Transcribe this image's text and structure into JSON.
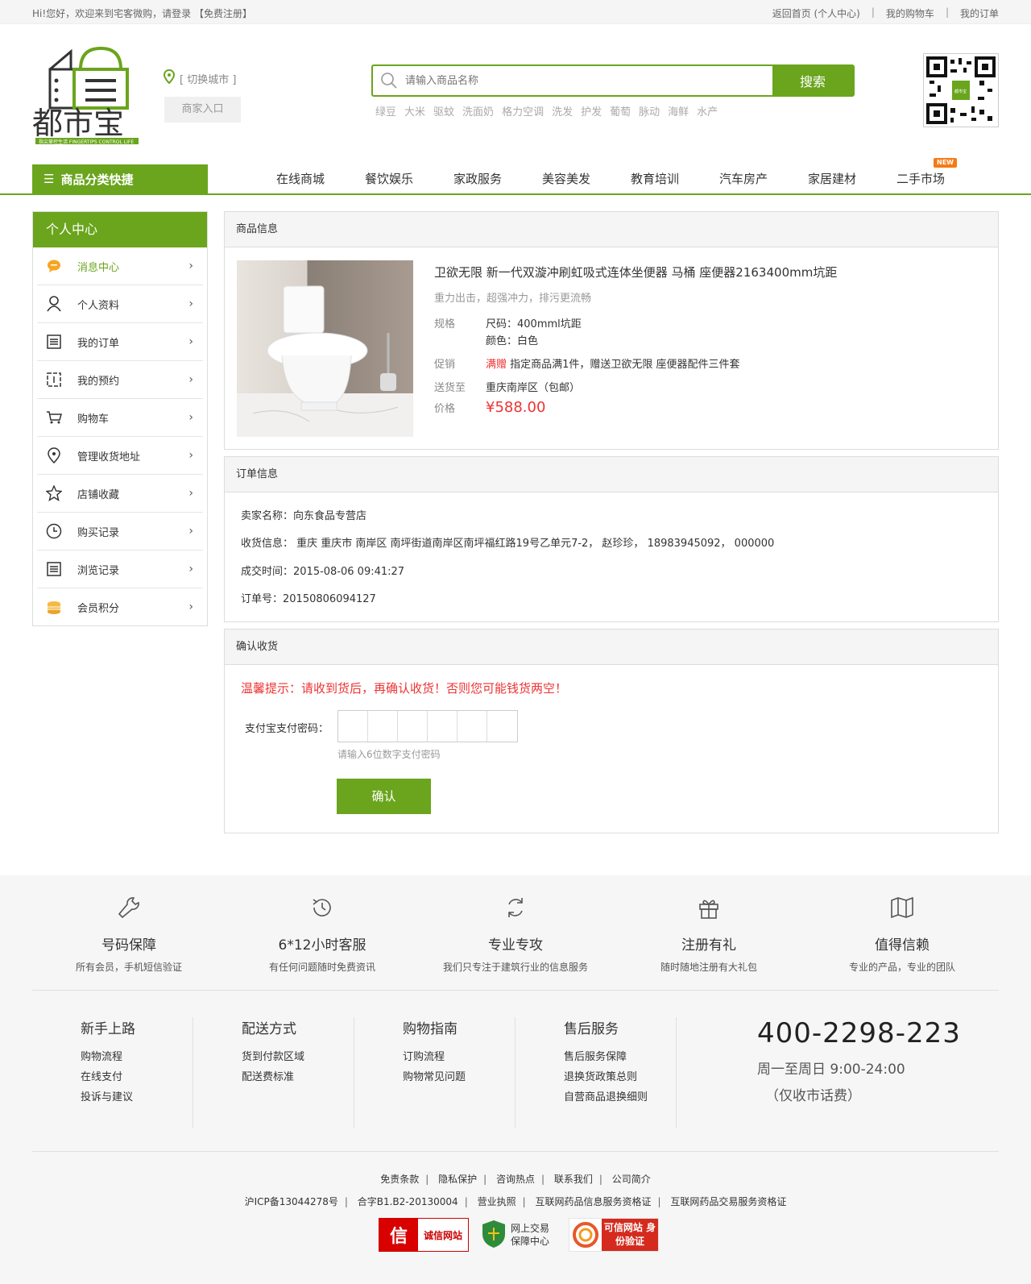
{
  "topbar": {
    "greeting": "Hi!您好，欢迎来到宅客微购，请登录 【免费注册】",
    "links": [
      "返回首页 (个人中心)",
      "我的购物车",
      "我的订单"
    ]
  },
  "header": {
    "logo_text": "都市宝",
    "logo_tagline": "指尖掌控生活 FINGERTIPS CONTROL LIFE",
    "city_switch": "[ 切换城市 ]",
    "merchant_entry": "商家入口",
    "search_placeholder": "请输入商品名称",
    "search_button": "搜索",
    "hotwords": [
      "绿豆",
      "大米",
      "驱蚊",
      "洗面奶",
      "格力空调",
      "洗发",
      "护发",
      "葡萄",
      "脉动",
      "海鲜",
      "水产"
    ],
    "qr_label": "都市宝"
  },
  "nav": {
    "category_label": "商品分类快捷",
    "items": [
      "在线商城",
      "餐饮娱乐",
      "家政服务",
      "美容美发",
      "教育培训",
      "汽车房产",
      "家居建材",
      "二手市场"
    ],
    "new_badge": "NEW"
  },
  "sidebar": {
    "title": "个人中心",
    "items": [
      {
        "label": "消息中心",
        "icon": "message-icon"
      },
      {
        "label": "个人资料",
        "icon": "user-icon"
      },
      {
        "label": "我的订单",
        "icon": "order-icon"
      },
      {
        "label": "我的预约",
        "icon": "appointment-icon"
      },
      {
        "label": "购物车",
        "icon": "cart-icon"
      },
      {
        "label": "管理收货地址",
        "icon": "location-icon"
      },
      {
        "label": "店铺收藏",
        "icon": "star-icon"
      },
      {
        "label": "购买记录",
        "icon": "clock-icon"
      },
      {
        "label": "浏览记录",
        "icon": "list-icon"
      },
      {
        "label": "会员积分",
        "icon": "coins-icon"
      }
    ]
  },
  "product": {
    "section_title": "商品信息",
    "title": "卫欲无限 新一代双漩冲刷虹吸式连体坐便器 马桶 座便器2163400mm坑距",
    "subtitle": "重力出击，超强冲力，排污更流畅",
    "spec_label": "规格",
    "spec_size": "尺码：400mml坑距",
    "spec_color": "颜色：白色",
    "promo_label": "促销",
    "promo_tag": "满赠",
    "promo_text": "指定商品满1件，赠送卫欲无限 座便器配件三件套",
    "ship_label": "送货至",
    "ship_text": "重庆南岸区（包邮）",
    "price_label": "价格",
    "price": "¥588.00"
  },
  "order": {
    "section_title": "订单信息",
    "seller": "卖家名称：向东食品专营店",
    "address": "收货信息：  重庆 重庆市 南岸区 南坪街道南岸区南坪福红路19号乙单元7-2，  赵珍珍，  18983945092，  000000",
    "time": "成交时间：2015-08-06 09:41:27",
    "number": "订单号：20150806094127"
  },
  "confirm": {
    "section_title": "确认收货",
    "warning": "温馨提示：请收到货后，再确认收货！否则您可能钱货两空！",
    "password_label": "支付宝支付密码：",
    "password_hint": "请输入6位数字支付密码",
    "button": "确认"
  },
  "footer": {
    "features": [
      {
        "title": "号码保障",
        "desc": "所有会员，手机短信验证",
        "icon": "wrench-icon"
      },
      {
        "title": "6*12小时客服",
        "desc": "有任何问题随时免费资讯",
        "icon": "history-icon"
      },
      {
        "title": "专业专攻",
        "desc": "我们只专注于建筑行业的信息服务",
        "icon": "refresh-icon"
      },
      {
        "title": "注册有礼",
        "desc": "随时随地注册有大礼包",
        "icon": "gift-icon"
      },
      {
        "title": "值得信赖",
        "desc": "专业的产品，专业的团队",
        "icon": "map-icon"
      }
    ],
    "columns": [
      {
        "title": "新手上路",
        "links": [
          "购物流程",
          "在线支付",
          "投诉与建议"
        ]
      },
      {
        "title": "配送方式",
        "links": [
          "货到付款区域",
          "配送费标准"
        ]
      },
      {
        "title": "购物指南",
        "links": [
          "订购流程",
          "购物常见问题"
        ]
      },
      {
        "title": "售后服务",
        "links": [
          "售后服务保障",
          "退换货政策总则",
          "自营商品退换细则"
        ]
      }
    ],
    "phone": "400-2298-223",
    "hours": "周一至周日 9:00-24:00",
    "note": "（仅收市话费）",
    "links_row1": [
      "免责条款",
      "隐私保护",
      "咨询热点",
      "联系我们",
      "公司简介"
    ],
    "links_row2": [
      "沪ICP备13044278号",
      "合字B1.B2-20130004",
      "营业执照",
      "互联网药品信息服务资格证",
      "互联网药品交易服务资格证"
    ],
    "badges": [
      "诚信网站",
      "网上交易 保障中心",
      "可信网站 身份验证"
    ]
  },
  "colors": {
    "accent": "#6aa51d",
    "price": "#e33333"
  }
}
